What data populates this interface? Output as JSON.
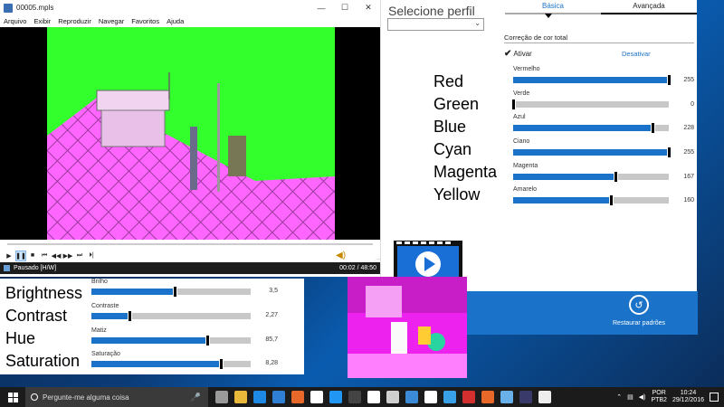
{
  "player": {
    "title": "00005.mpls",
    "window_buttons": [
      "—",
      "☐",
      "✕"
    ],
    "menu": [
      "Arquivo",
      "Exibir",
      "Reproduzir",
      "Navegar",
      "Favoritos",
      "Ajuda"
    ],
    "status": "Pausado [H/W]",
    "time": "00:02 / 48:50",
    "seek_progress": 0.0
  },
  "settings": {
    "profile_label": "Selecione perfil",
    "profile_value": "",
    "tab_basic": "Básica",
    "tab_advanced": "Avançada",
    "section_title": "Correção de cor total",
    "enable_label": "Ativar",
    "disable_label": "Desativar",
    "restore_label": "Restaurar padrões",
    "color_sliders": [
      {
        "name": "Vermelho",
        "value": "255",
        "level": 1.0
      },
      {
        "name": "Verde",
        "value": "0",
        "level": 0.0
      },
      {
        "name": "Azul",
        "value": "228",
        "level": 0.894
      },
      {
        "name": "Ciano",
        "value": "255",
        "level": 1.0
      },
      {
        "name": "Magenta",
        "value": "167",
        "level": 0.655
      },
      {
        "name": "Amarelo",
        "value": "160",
        "level": 0.627
      }
    ]
  },
  "overlay_labels": {
    "colors": [
      "Red",
      "Green",
      "Blue",
      "Cyan",
      "Magenta",
      "Yellow"
    ],
    "image": [
      "Brightness",
      "Contrast",
      "Hue",
      "Saturation"
    ]
  },
  "image_sliders": [
    {
      "name": "Brilho",
      "value": "3,5",
      "level": 0.52
    },
    {
      "name": "Contraste",
      "value": "2,27",
      "level": 0.24
    },
    {
      "name": "Matiz",
      "value": "85,7",
      "level": 0.73
    },
    {
      "name": "Saturação",
      "value": "8,28",
      "level": 0.81
    }
  ],
  "taskbar": {
    "search_placeholder": "Pergunte-me alguma coisa",
    "lang_top": "POR",
    "lang_bottom": "PTB2",
    "time": "10:24",
    "date": "29/12/2016",
    "icon_colors": [
      "#9a9a9a",
      "#e8b83a",
      "#1e88e5",
      "#2f7fd4",
      "#e8682a",
      "#ffffff",
      "#2196f3",
      "#444444",
      "#ffffff",
      "#cfcfcf",
      "#3a8ad8",
      "#ffffff",
      "#39a1e8",
      "#d32f2f",
      "#e8682a",
      "#6ab0e8",
      "#3a3a6a",
      "#eeeeee"
    ]
  }
}
